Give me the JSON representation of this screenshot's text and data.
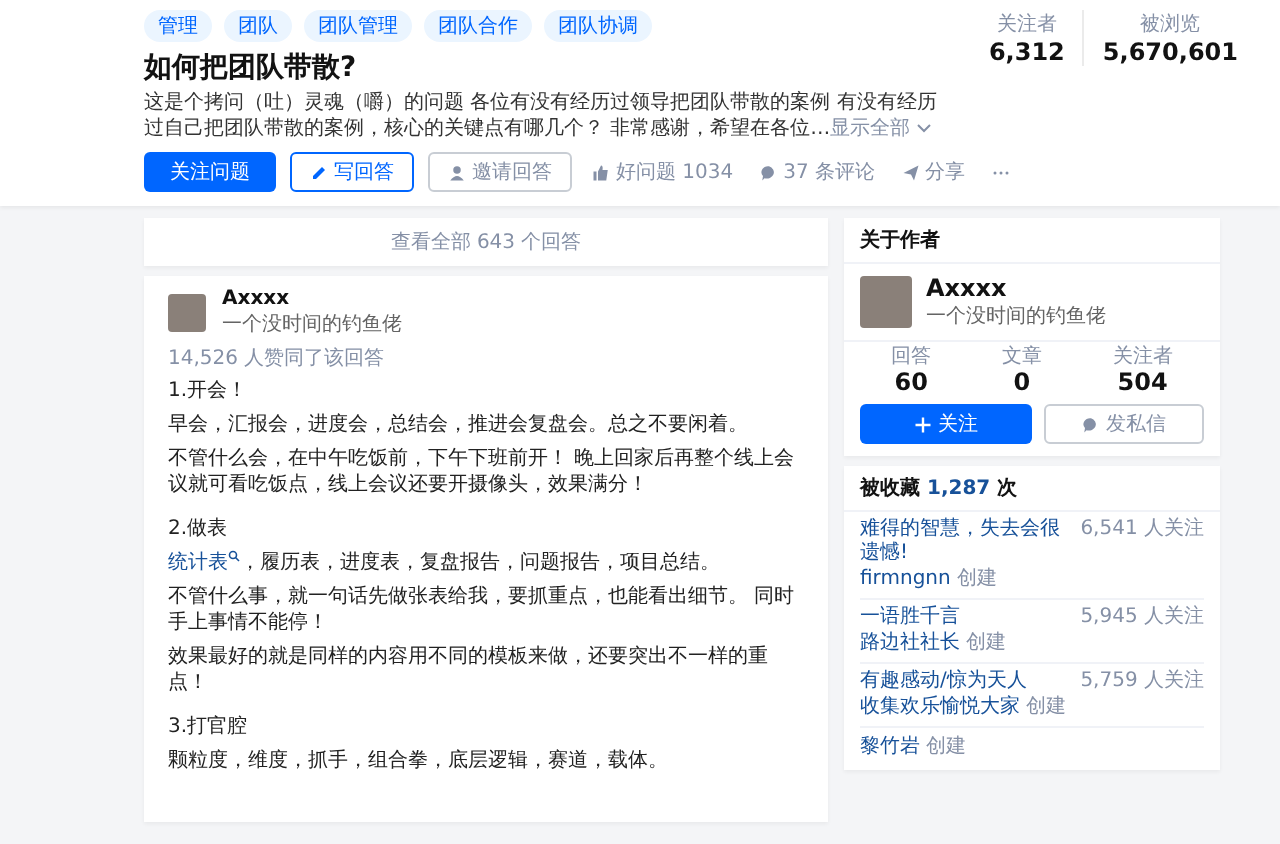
{
  "tags": [
    "管理",
    "团队",
    "团队管理",
    "团队合作",
    "团队协调"
  ],
  "question": {
    "title": "如何把团队带散?",
    "description": "这是个拷问（吐）灵魂（嚼）的问题 各位有没有经历过领导把团队带散的案例 有没有经历过自己把团队带散的案例，核心的关键点有哪几个？ 非常感谢，希望在各位…",
    "show_all": "显示全部"
  },
  "actions": [
    {
      "kind": "primary",
      "label": "关注问题"
    },
    {
      "kind": "outline",
      "label": "写回答"
    },
    {
      "kind": "ghost",
      "label": "邀请回答"
    },
    {
      "kind": "link",
      "label": "好问题 1034"
    },
    {
      "kind": "link",
      "label": "37 条评论"
    },
    {
      "kind": "link",
      "label": "分享"
    },
    {
      "kind": "more"
    }
  ],
  "stats": [
    {
      "label": "关注者",
      "value": "6,312"
    },
    {
      "label": "被浏览",
      "value": "5,670,601"
    }
  ],
  "view_all": "查看全部 643 个回答",
  "answer": {
    "author": "Axxxx",
    "bio": "一个没时间的钓鱼佬",
    "votes": "14,526 人赞同了该回答",
    "paragraphs": [
      {
        "kind": "heading",
        "text": "1.开会！"
      },
      {
        "kind": "text",
        "text": "早会，汇报会，进度会，总结会，推进会复盘会。总之不要闲着。"
      },
      {
        "kind": "text",
        "text": "不管什么会，在中午吃饭前，下午下班前开！ 晚上回家后再整个线上会议就可看吃饭点，线上会议还要开摄像头，效果满分！"
      },
      {
        "kind": "heading",
        "text": "2.做表"
      },
      {
        "kind": "text",
        "link": "统计表",
        "text": "，履历表，进度表，复盘报告，问题报告，项目总结。"
      },
      {
        "kind": "text",
        "text": "不管什么事，就一句话先做张表给我，要抓重点，也能看出细节。 同时手上事情不能停！"
      },
      {
        "kind": "text",
        "text": "效果最好的就是同样的内容用不同的模板来做，还要突出不一样的重点！"
      },
      {
        "kind": "heading",
        "text": "3.打官腔"
      },
      {
        "kind": "text",
        "text": "颗粒度，维度，抓手，组合拳，底层逻辑，赛道，载体。"
      }
    ]
  },
  "about_author": {
    "title": "关于作者",
    "name": "Axxxx",
    "bio": "一个没时间的钓鱼佬",
    "stats": [
      {
        "label": "回答",
        "value": "60"
      },
      {
        "label": "文章",
        "value": "0"
      },
      {
        "label": "关注者",
        "value": "504"
      }
    ],
    "buttons": [
      {
        "kind": "primary",
        "label": "关注"
      },
      {
        "kind": "outline",
        "label": "发私信"
      }
    ]
  },
  "collections": {
    "label": "被收藏",
    "count": "1,287",
    "unit": "次",
    "items": [
      {
        "title": "难得的智慧，失去会很遗憾!",
        "followers": "6,541 人关注",
        "creator": "firmngnn",
        "created": "创建"
      },
      {
        "title": "一语胜千言",
        "followers": "5,945 人关注",
        "creator": "路边社社长",
        "created": "创建"
      },
      {
        "title": "有趣感动/惊为天人",
        "followers": "5,759 人关注",
        "creator": "收集欢乐愉悦大家",
        "created": "创建"
      },
      {
        "creator": "黎竹岩",
        "created": "创建"
      }
    ]
  }
}
